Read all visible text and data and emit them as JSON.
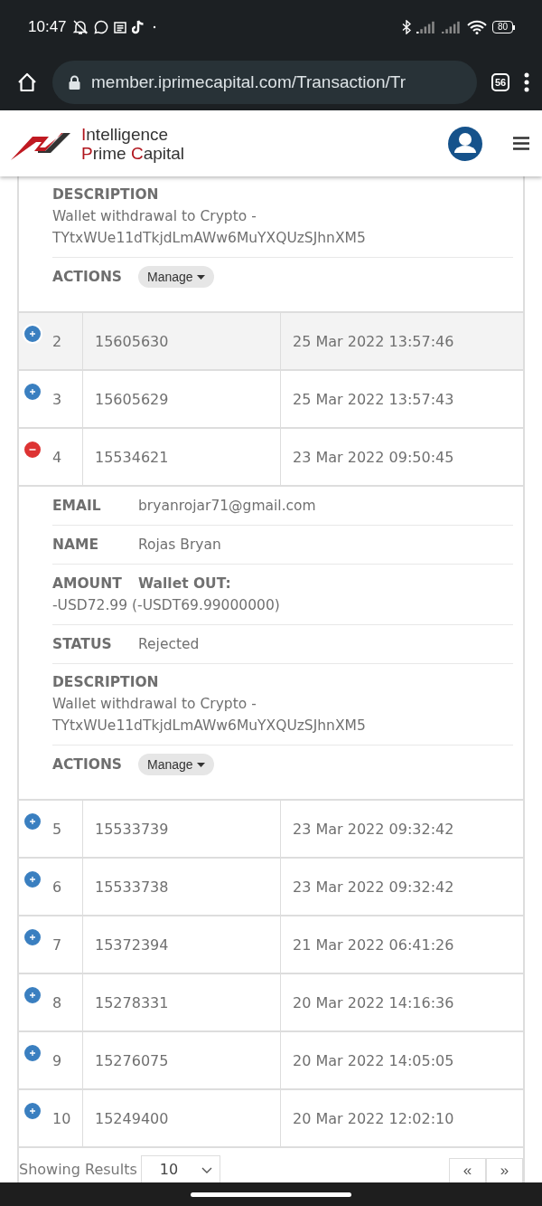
{
  "status_bar": {
    "time": "10:47",
    "battery": "80"
  },
  "browser": {
    "url": "member.iprimecapital.com/Transaction/Tr",
    "tab_count": "56"
  },
  "header": {
    "logo_line1": "Intelligence",
    "logo_line2": "Prime Capital"
  },
  "details_above": {
    "fields": [
      {
        "kind": "stacked",
        "label": "DESCRIPTION",
        "value": "Wallet withdrawal to Crypto - TYtxWUe11dTkjdLmAWw6MuYXQUzSJhnXM5"
      },
      {
        "kind": "action",
        "label": "ACTIONS",
        "button": "Manage"
      }
    ]
  },
  "rows": [
    {
      "index": "2",
      "id": "15605630",
      "date": "25 Mar 2022 13:57:46",
      "expanded": false,
      "selected": true
    },
    {
      "index": "3",
      "id": "15605629",
      "date": "25 Mar 2022 13:57:43",
      "expanded": false,
      "selected": false
    },
    {
      "index": "4",
      "id": "15534621",
      "date": "23 Mar 2022 09:50:45",
      "expanded": true,
      "selected": false,
      "details": {
        "fields": [
          {
            "kind": "inline",
            "label": "EMAIL",
            "value": "bryanrojar71@gmail.com"
          },
          {
            "kind": "inline",
            "label": "NAME",
            "value": "Rojas Bryan"
          },
          {
            "kind": "titled",
            "label": "AMOUNT",
            "title": "Wallet OUT:",
            "value": "-USD72.99 (-USDT69.99000000)"
          },
          {
            "kind": "inline",
            "label": "STATUS",
            "value": "Rejected"
          },
          {
            "kind": "stacked",
            "label": "DESCRIPTION",
            "value": "Wallet withdrawal to Crypto - TYtxWUe11dTkjdLmAWw6MuYXQUzSJhnXM5"
          },
          {
            "kind": "action",
            "label": "ACTIONS",
            "button": "Manage"
          }
        ]
      }
    },
    {
      "index": "5",
      "id": "15533739",
      "date": "23 Mar 2022 09:32:42",
      "expanded": false,
      "selected": false
    },
    {
      "index": "6",
      "id": "15533738",
      "date": "23 Mar 2022 09:32:42",
      "expanded": false,
      "selected": false
    },
    {
      "index": "7",
      "id": "15372394",
      "date": "21 Mar 2022 06:41:26",
      "expanded": false,
      "selected": false
    },
    {
      "index": "8",
      "id": "15278331",
      "date": "20 Mar 2022 14:16:36",
      "expanded": false,
      "selected": false
    },
    {
      "index": "9",
      "id": "15276075",
      "date": "20 Mar 2022 14:05:05",
      "expanded": false,
      "selected": false
    },
    {
      "index": "10",
      "id": "15249400",
      "date": "20 Mar 2022 12:02:10",
      "expanded": false,
      "selected": false
    }
  ],
  "footer": {
    "label": "Showing Results",
    "page_size": "10",
    "pager": [
      "«",
      "»"
    ]
  }
}
